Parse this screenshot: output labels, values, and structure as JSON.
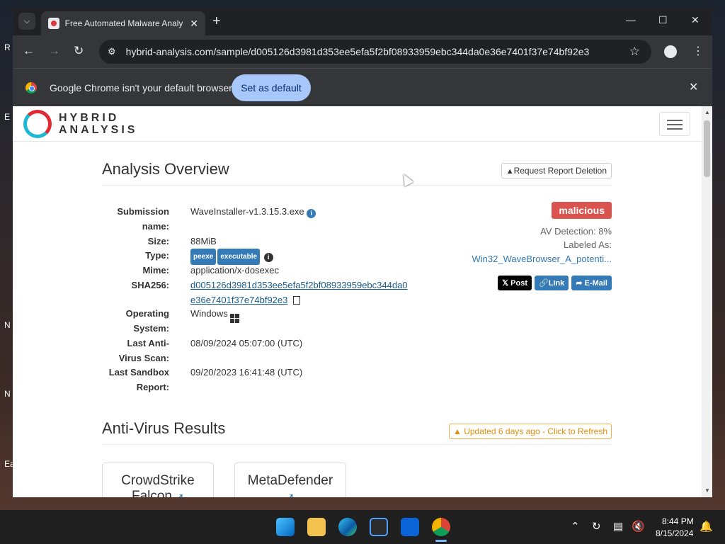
{
  "desktop": {
    "icon_labels": [
      "R",
      "E",
      "N",
      "N",
      "Ea"
    ]
  },
  "browser": {
    "tab_title": "Free Automated Malware Analysis",
    "url": "hybrid-analysis.com/sample/d005126d3981d353ee5efa5f2bf08933959ebc344da0e36e7401f37e74bf92e3",
    "infobar_text": "Google Chrome isn't your default browser",
    "set_default_label": "Set as default"
  },
  "site": {
    "logo_line1": "HYBRID",
    "logo_line2": "ANALYSIS"
  },
  "overview": {
    "title": "Analysis Overview",
    "request_deletion": "Request Report Deletion",
    "fields": {
      "submission_label_1": "Submission",
      "submission_label_2": "name:",
      "submission_value": "WaveInstaller-v1.3.15.3.exe",
      "size_label": "Size:",
      "size_value": "88MiB",
      "type_label": "Type:",
      "type_badge_1": "peexe",
      "type_badge_2": "executable",
      "mime_label": "Mime:",
      "mime_value": "application/x-dosexec",
      "sha_label": "SHA256:",
      "sha_line1": "d005126d3981d353ee5efa5f2bf08933959ebc344da0",
      "sha_line2": "e36e7401f37e74bf92e3",
      "os_label_1": "Operating",
      "os_label_2": "System:",
      "os_value": "Windows",
      "av_scan_label_1": "Last Anti-",
      "av_scan_label_2": "Virus Scan:",
      "av_scan_value": "08/09/2024 05:07:00 (UTC)",
      "sandbox_label_1": "Last Sandbox",
      "sandbox_label_2": "Report:",
      "sandbox_value": "09/20/2023 16:41:48 (UTC)"
    },
    "verdict": "malicious",
    "av_detection": "AV Detection: 8%",
    "labeled_as": "Labeled As:",
    "labeled_value": "Win32_WaveBrowser_A_potenti...",
    "share": {
      "post": "Post",
      "link": "Link",
      "email": "E-Mail"
    }
  },
  "av_results": {
    "title": "Anti-Virus Results",
    "updated": "Updated 6 days ago - Click to Refresh",
    "cards": [
      {
        "name_1": "CrowdStrike",
        "name_2": "Falcon"
      },
      {
        "name_1": "MetaDefender",
        "name_2": ""
      }
    ]
  },
  "taskbar": {
    "time": "8:44 PM",
    "date": "8/15/2024"
  }
}
